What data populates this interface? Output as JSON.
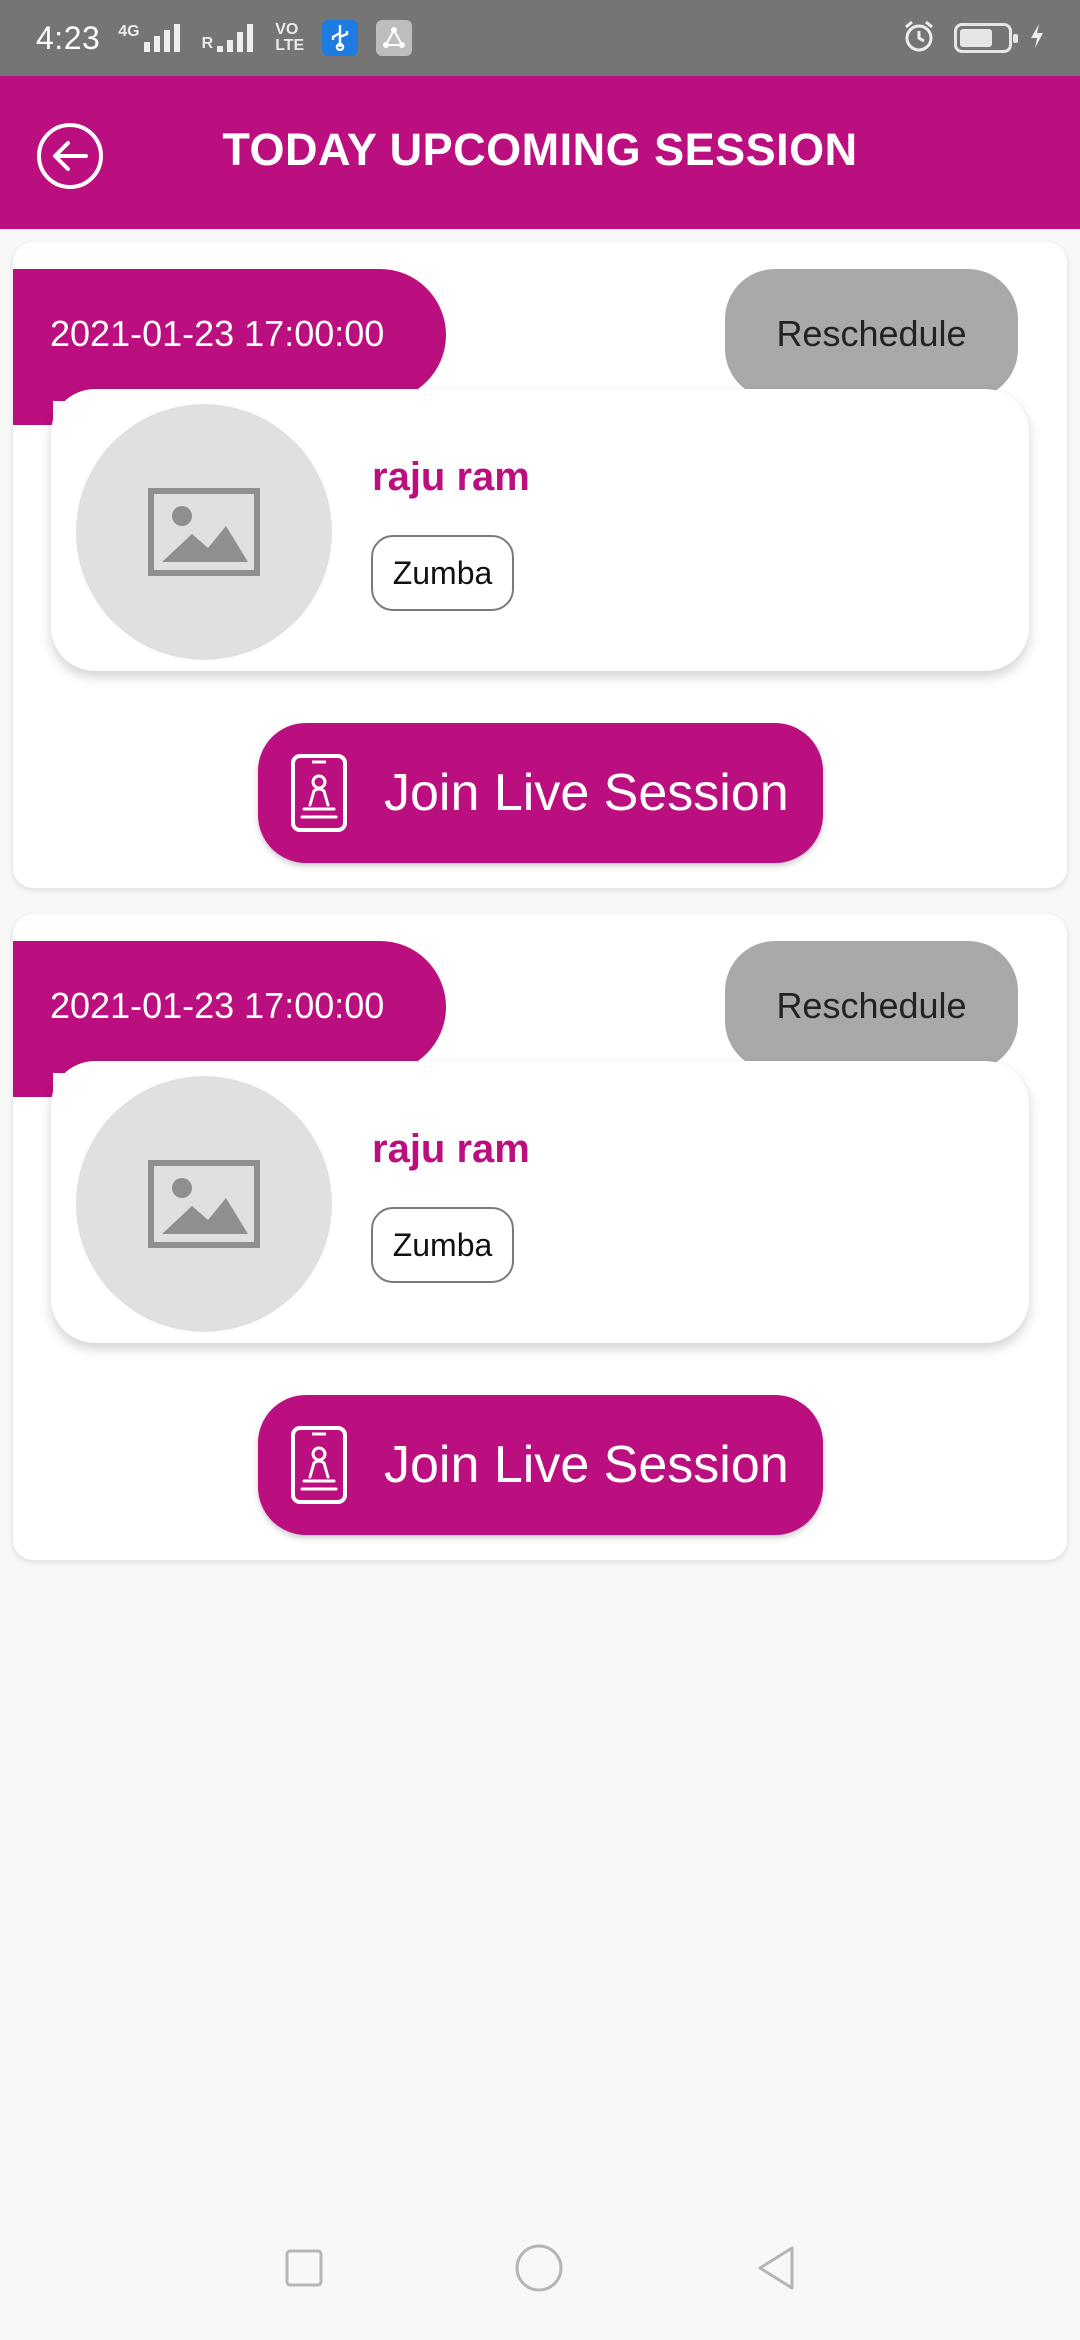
{
  "status_bar": {
    "time": "4:23",
    "network_4g": "4G",
    "roaming": "R",
    "volte_top": "VO",
    "volte_bottom": "LTE",
    "icons": [
      "signal-icon",
      "usb-icon",
      "share-icon",
      "alarm-icon",
      "battery-icon",
      "charging-icon"
    ]
  },
  "header": {
    "title": "TODAY UPCOMING SESSION",
    "back_icon": "back-arrow-icon"
  },
  "sessions": [
    {
      "datetime": "2021-01-23 17:00:00",
      "reschedule_label": "Reschedule",
      "trainer_name": "raju ram",
      "category": "Zumba",
      "join_label": "Join Live Session"
    },
    {
      "datetime": "2021-01-23 17:00:00",
      "reschedule_label": "Reschedule",
      "trainer_name": "raju ram",
      "category": "Zumba",
      "join_label": "Join Live Session"
    }
  ],
  "colors": {
    "primary": "#bc0f7f",
    "status_bar": "#757575",
    "reschedule": "#a9a9a9",
    "avatar_placeholder": "#e0e0e0",
    "background": "#f8f8f8"
  },
  "nav_bar": {
    "icons": [
      "recent-apps-icon",
      "home-icon",
      "back-icon"
    ]
  }
}
